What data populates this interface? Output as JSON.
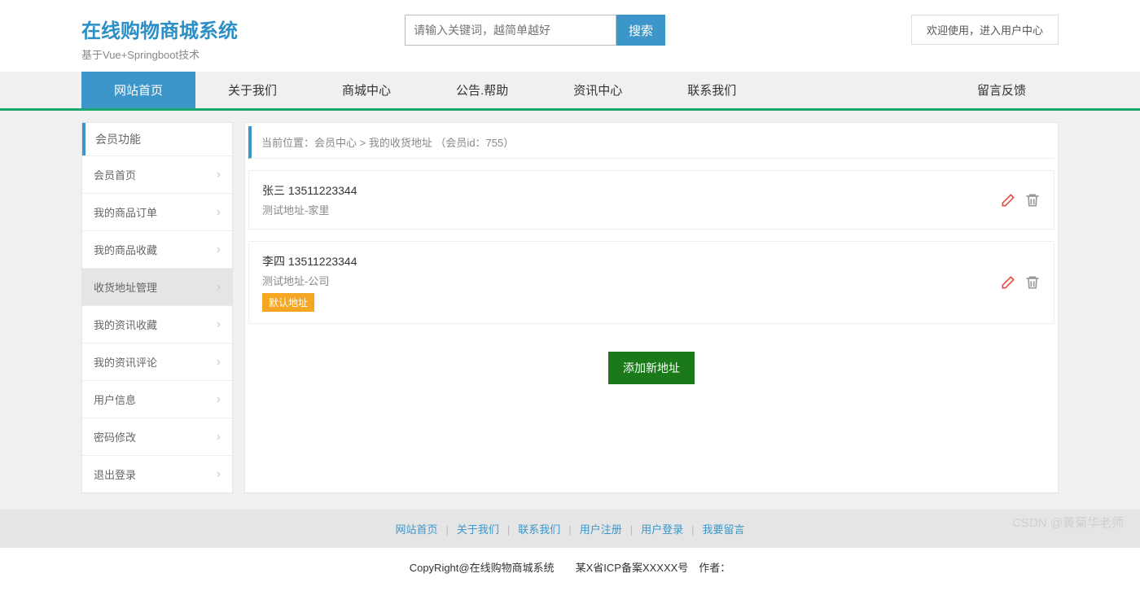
{
  "header": {
    "title": "在线购物商城系统",
    "subtitle": "基于Vue+Springboot技术",
    "search_placeholder": "请输入关键词，越简单越好",
    "search_button": "搜索",
    "welcome": "欢迎使用，进入用户中心"
  },
  "nav": {
    "items": [
      "网站首页",
      "关于我们",
      "商城中心",
      "公告.帮助",
      "资讯中心",
      "联系我们"
    ],
    "feedback": "留言反馈",
    "active_index": 0
  },
  "sidebar": {
    "title": "会员功能",
    "items": [
      {
        "label": "会员首页"
      },
      {
        "label": "我的商品订单"
      },
      {
        "label": "我的商品收藏"
      },
      {
        "label": "收货地址管理"
      },
      {
        "label": "我的资讯收藏"
      },
      {
        "label": "我的资讯评论"
      },
      {
        "label": "用户信息"
      },
      {
        "label": "密码修改"
      },
      {
        "label": "退出登录"
      }
    ],
    "active_index": 3
  },
  "breadcrumb": "当前位置：会员中心 > 我的收货地址 （会员id：755）",
  "addresses": [
    {
      "name": "张三",
      "phone": "13511223344",
      "detail": "测试地址-家里",
      "is_default": false
    },
    {
      "name": "李四",
      "phone": "13511223344",
      "detail": "测试地址-公司",
      "is_default": true
    }
  ],
  "default_label": "默认地址",
  "add_button": "添加新地址",
  "footer": {
    "links": [
      "网站首页",
      "关于我们",
      "联系我们",
      "用户注册",
      "用户登录",
      "我要留言"
    ],
    "copyright": "CopyRight@在线购物商城系统　　某X省ICP备案XXXXX号　作者："
  },
  "watermark": "CSDN @黄菊华老师"
}
